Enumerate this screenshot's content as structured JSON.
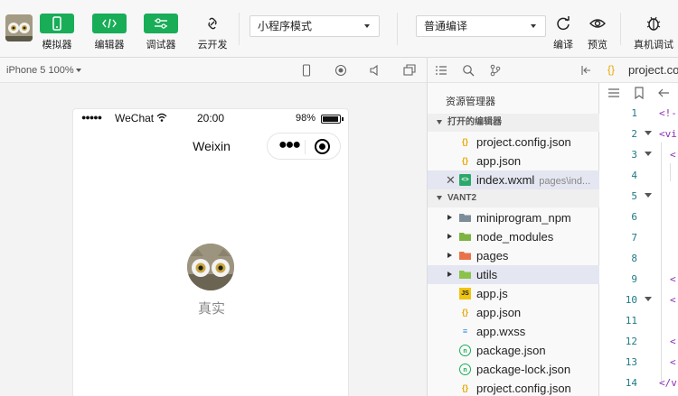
{
  "toolbar": {
    "buttons": [
      {
        "label": "模拟器",
        "icon": "phone-icon"
      },
      {
        "label": "编辑器",
        "icon": "code-icon"
      },
      {
        "label": "调试器",
        "icon": "sliders-icon"
      },
      {
        "label": "云开发",
        "icon": "cloud-link-icon"
      }
    ],
    "mode_select": "小程序模式",
    "compile_select": "普通编译",
    "actions": [
      {
        "label": "编译",
        "icon": "refresh-icon"
      },
      {
        "label": "预览",
        "icon": "eye-icon"
      },
      {
        "label": "真机调试",
        "icon": "bug-icon"
      }
    ]
  },
  "simulator": {
    "device": "iPhone 5 100%",
    "status": {
      "carrier": "WeChat",
      "time": "20:00",
      "battery": "98%",
      "dots": "●●●●●"
    },
    "nav_title": "Weixin",
    "user_name": "真实"
  },
  "explorer": {
    "title": "资源管理器",
    "open_editors_label": "打开的编辑器",
    "open_editors": [
      {
        "name": "project.config.json",
        "icon": "json"
      },
      {
        "name": "app.json",
        "icon": "json"
      },
      {
        "name": "index.wxml",
        "path": "pages\\ind...",
        "icon": "wxml"
      }
    ],
    "project_label": "VANT2",
    "files": [
      {
        "name": "miniprogram_npm",
        "icon": "folder",
        "color": "#7d8c99"
      },
      {
        "name": "node_modules",
        "icon": "folder",
        "color": "#7cb342"
      },
      {
        "name": "pages",
        "icon": "folder",
        "color": "#e8734a"
      },
      {
        "name": "utils",
        "icon": "folder",
        "color": "#8bc34a"
      },
      {
        "name": "app.js",
        "icon": "js"
      },
      {
        "name": "app.json",
        "icon": "json"
      },
      {
        "name": "app.wxss",
        "icon": "wxss"
      },
      {
        "name": "package.json",
        "icon": "pkg"
      },
      {
        "name": "package-lock.json",
        "icon": "pkg"
      },
      {
        "name": "project.config.json",
        "icon": "json"
      }
    ]
  },
  "editor": {
    "tab": "project.config.json",
    "line_numbers": [
      "1",
      "2",
      "3",
      "4",
      "5",
      "6",
      "7",
      "8",
      "9",
      "10",
      "11",
      "12",
      "13",
      "14"
    ],
    "code_fragments": {
      "l1": "<!-",
      "l2": "<vi",
      "l3": "<",
      "l9": "<",
      "l10": "<",
      "l12": "<",
      "l13": "<",
      "l14": "</v"
    }
  },
  "colors": {
    "accent": "#19ad58",
    "selection": "#e4e6f1"
  }
}
